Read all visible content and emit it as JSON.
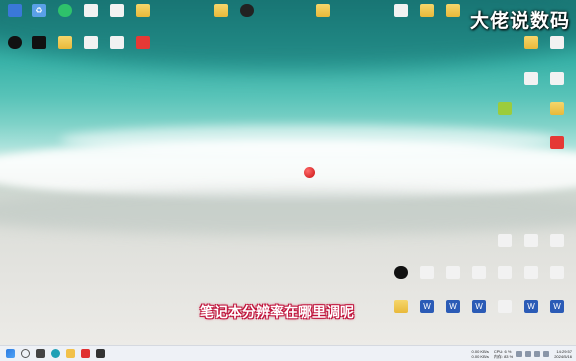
{
  "overlay": {
    "watermark": "大佬说数码",
    "subtitle": "笔记本分辨率在哪里调呢"
  },
  "taskbar": {
    "network": {
      "upload": "0.00 KB/s",
      "download": "0.00 KB/s"
    },
    "cpu": "CPU: 6 %",
    "memory": "内存: 83 %",
    "time": "14:29:57",
    "date": "2024/5/16"
  },
  "colors": {
    "subtitle_outline": "#c0133b",
    "taskbar_bg": "#eef1f6"
  }
}
